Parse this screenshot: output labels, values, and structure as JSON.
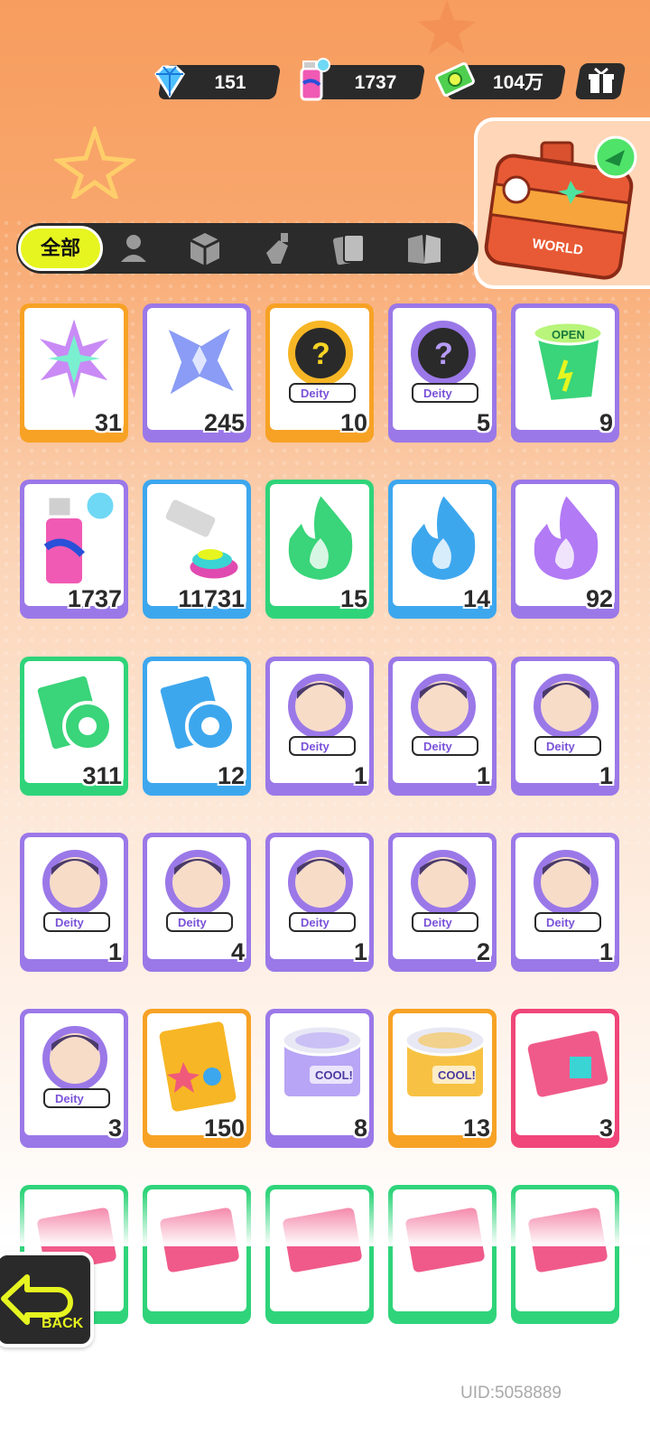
{
  "currencies": [
    {
      "name": "diamond-icon",
      "value": "151"
    },
    {
      "name": "spray-can-icon",
      "value": "1737"
    },
    {
      "name": "cash-icon",
      "value": "104万"
    }
  ],
  "tabs": {
    "active_label": "全部",
    "icons": [
      "person-icon",
      "box-icon",
      "spray-icon",
      "cards-icon",
      "book-icon"
    ]
  },
  "chest": {
    "label": "WORLD"
  },
  "items": [
    {
      "icon": "rainbow-star-icon",
      "count": "31",
      "rarity": "orange"
    },
    {
      "icon": "blue-star-icon",
      "count": "245",
      "rarity": "purple"
    },
    {
      "icon": "deity-mystery-gold-icon",
      "count": "10",
      "rarity": "orange",
      "tag": "Deity"
    },
    {
      "icon": "deity-mystery-purple-icon",
      "count": "5",
      "rarity": "purple",
      "tag": "Deity"
    },
    {
      "icon": "open-cup-icon",
      "count": "9",
      "rarity": "purple",
      "tag": "OPEN"
    },
    {
      "icon": "spray-can-icon",
      "count": "1737",
      "rarity": "purple"
    },
    {
      "icon": "paint-tube-icon",
      "count": "11731",
      "rarity": "blue"
    },
    {
      "icon": "green-flame-icon",
      "count": "15",
      "rarity": "green"
    },
    {
      "icon": "blue-flame-icon",
      "count": "14",
      "rarity": "blue"
    },
    {
      "icon": "purple-flame-icon",
      "count": "92",
      "rarity": "purple"
    },
    {
      "icon": "green-tape-icon",
      "count": "311",
      "rarity": "green"
    },
    {
      "icon": "blue-tape-icon",
      "count": "12",
      "rarity": "blue"
    },
    {
      "icon": "deity-avatar-icon",
      "count": "1",
      "rarity": "purple",
      "tag": "Deity"
    },
    {
      "icon": "deity-avatar-icon",
      "count": "1",
      "rarity": "purple",
      "tag": "Deity"
    },
    {
      "icon": "deity-avatar-icon",
      "count": "1",
      "rarity": "purple",
      "tag": "Deity"
    },
    {
      "icon": "deity-avatar-icon",
      "count": "1",
      "rarity": "purple",
      "tag": "Deity"
    },
    {
      "icon": "deity-avatar-icon",
      "count": "4",
      "rarity": "purple",
      "tag": "Deity"
    },
    {
      "icon": "deity-avatar-icon",
      "count": "1",
      "rarity": "purple",
      "tag": "Deity"
    },
    {
      "icon": "deity-avatar-icon",
      "count": "2",
      "rarity": "purple",
      "tag": "Deity"
    },
    {
      "icon": "deity-avatar-icon",
      "count": "1",
      "rarity": "purple",
      "tag": "Deity"
    },
    {
      "icon": "deity-avatar-icon",
      "count": "3",
      "rarity": "purple",
      "tag": "Deity"
    },
    {
      "icon": "sticker-pack-icon",
      "count": "150",
      "rarity": "orange"
    },
    {
      "icon": "purple-can-icon",
      "count": "8",
      "rarity": "purple",
      "tag": "COOL!"
    },
    {
      "icon": "orange-can-icon",
      "count": "13",
      "rarity": "orange",
      "tag": "COOL!"
    },
    {
      "icon": "pink-card-icon",
      "count": "3",
      "rarity": "pink"
    },
    {
      "icon": "green-card-icon",
      "count": "",
      "rarity": "green"
    },
    {
      "icon": "green-card-icon",
      "count": "",
      "rarity": "green"
    },
    {
      "icon": "green-card-icon",
      "count": "",
      "rarity": "green"
    },
    {
      "icon": "green-card-icon",
      "count": "",
      "rarity": "green"
    },
    {
      "icon": "green-card-icon",
      "count": "",
      "rarity": "green"
    }
  ],
  "colors": {
    "orange": "#f7a225",
    "purple": "#9b78e8",
    "blue": "#3da7ee",
    "green": "#2fd47a",
    "pink": "#f0467a"
  },
  "back_button": {
    "label": "BACK"
  },
  "uid": "UID:5058889"
}
